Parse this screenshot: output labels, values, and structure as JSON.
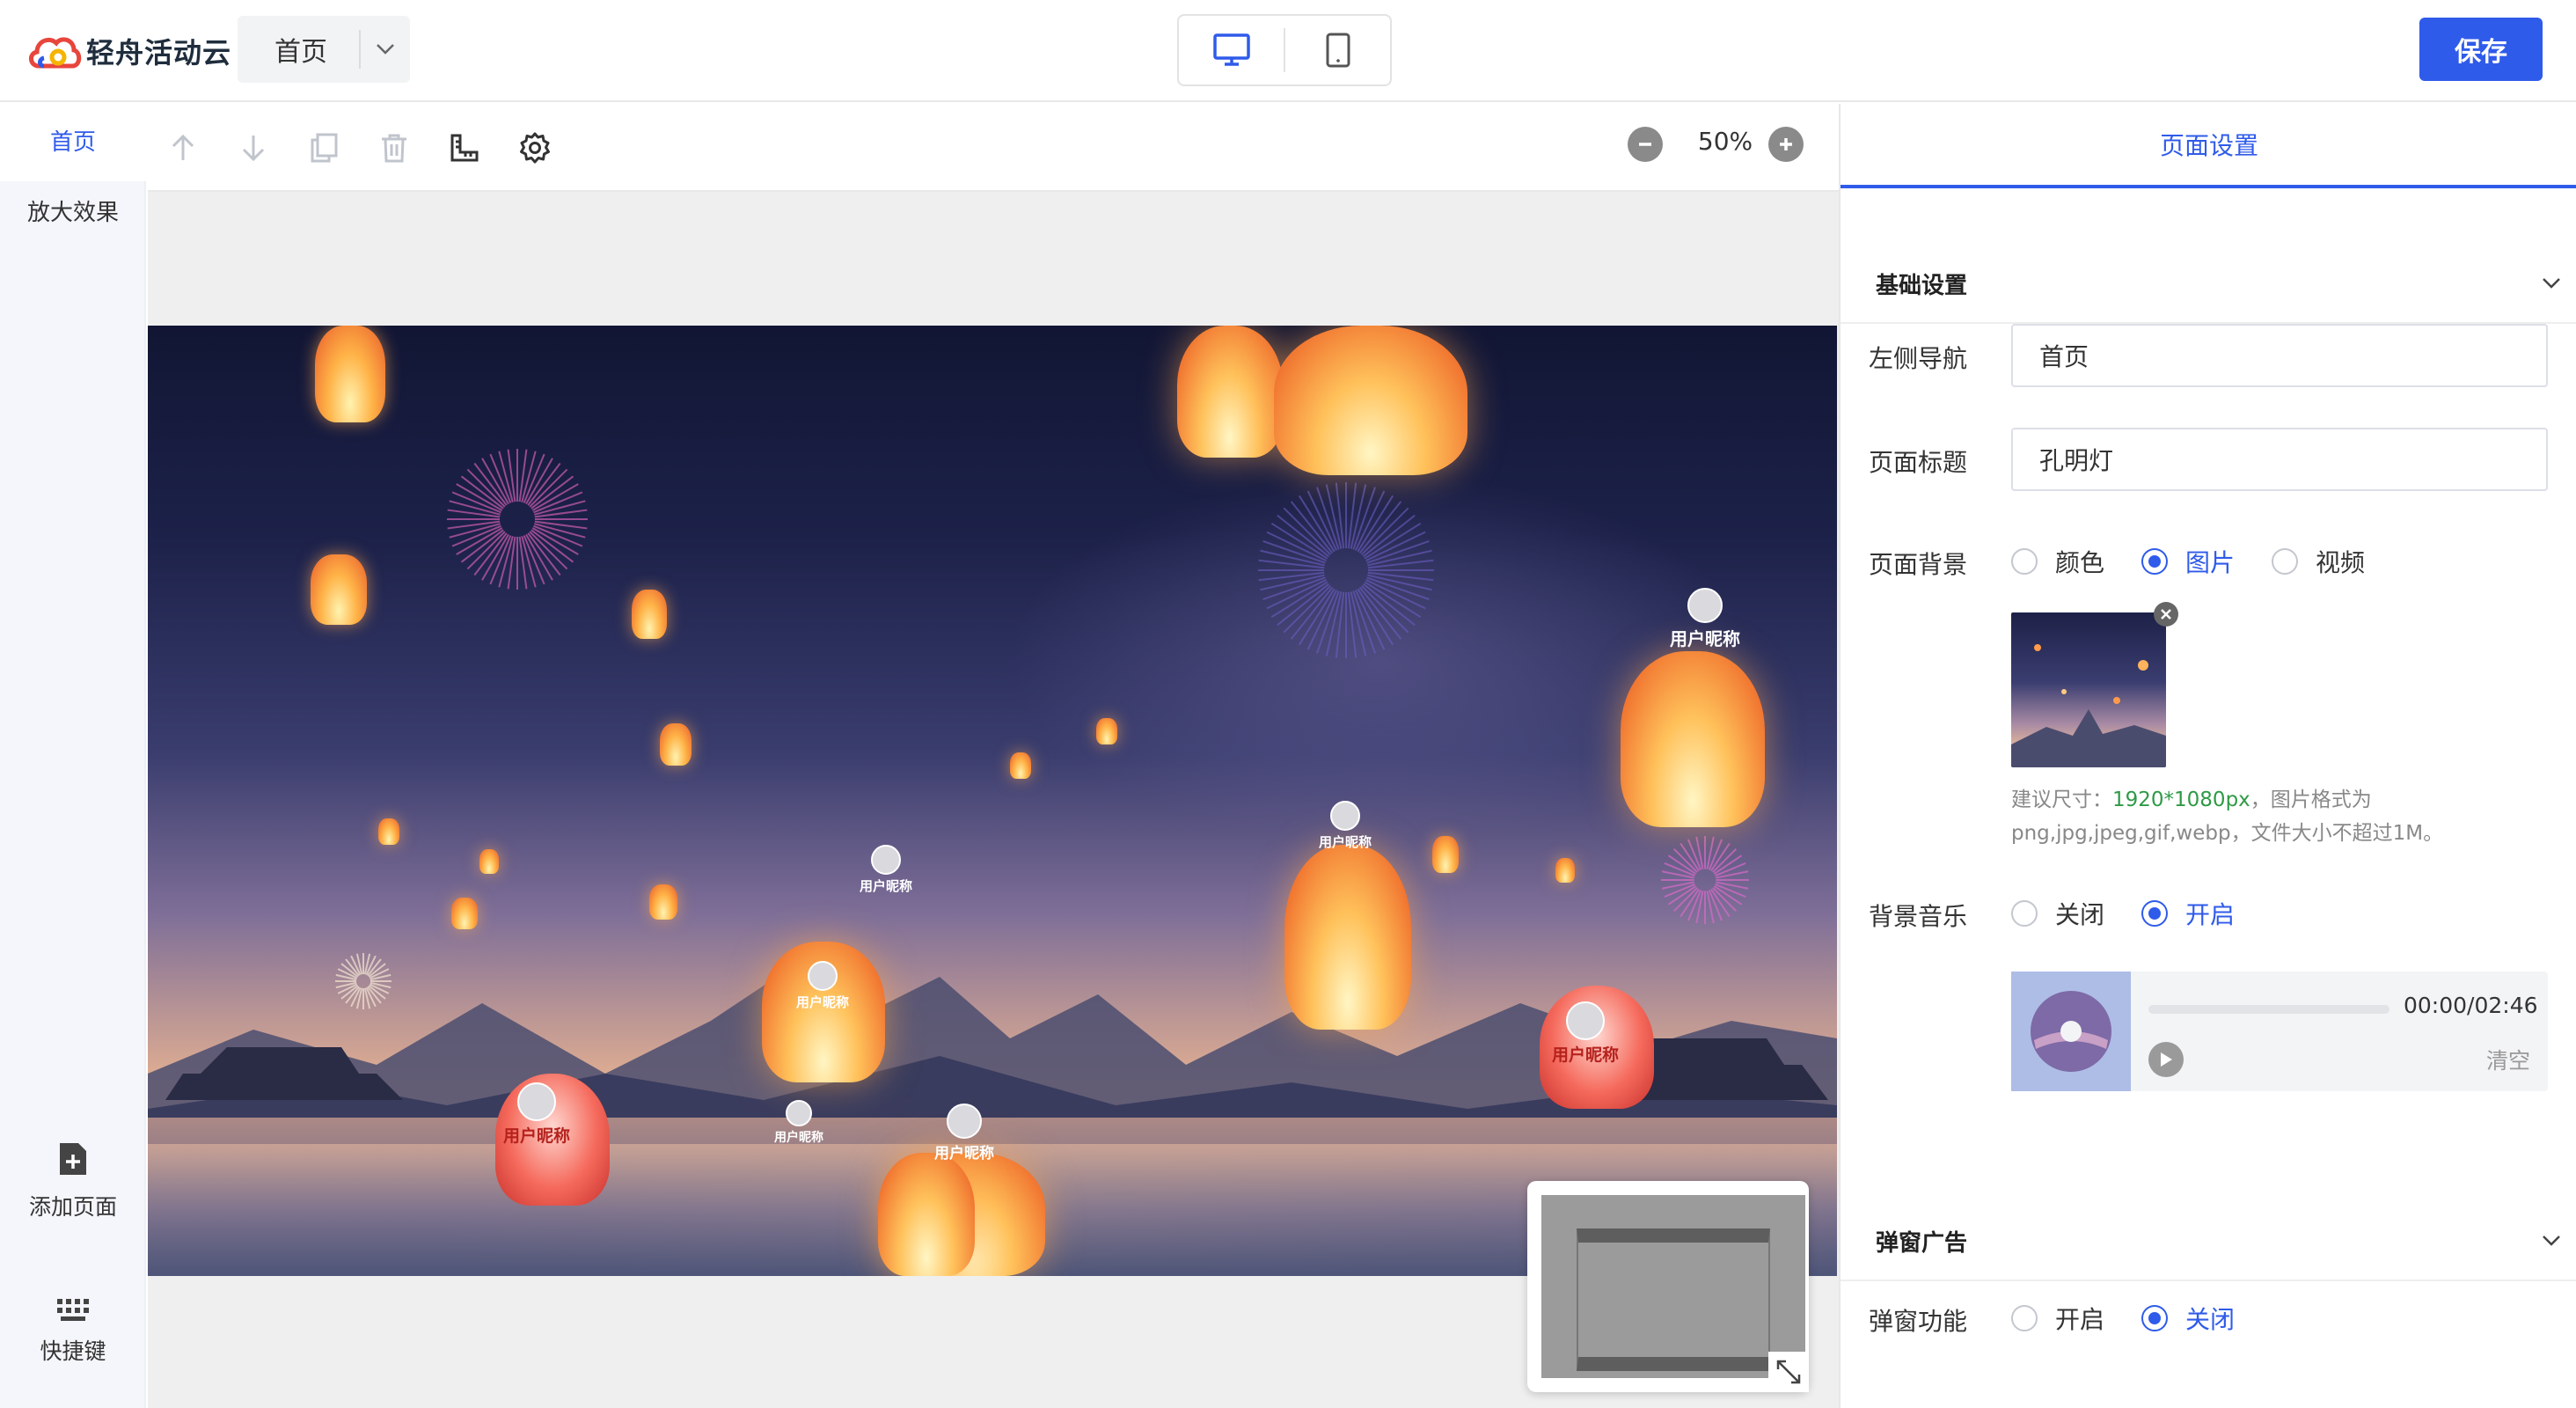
{
  "app": {
    "brand_name": "轻舟活动云",
    "current_page": "首页",
    "save_label": "保存"
  },
  "colors": {
    "accent": "#2f5bea",
    "hint_green": "#2e9a46"
  },
  "left_rail": {
    "pages": [
      {
        "label": "首页",
        "active": true
      },
      {
        "label": "放大效果",
        "active": false
      }
    ],
    "add_page_label": "添加页面",
    "shortcuts_label": "快捷键"
  },
  "toolbar": {
    "icons": [
      "arrow-up-icon",
      "arrow-down-icon",
      "copy-icon",
      "trash-icon",
      "ruler-icon",
      "gear-icon"
    ],
    "zoom": "50%"
  },
  "preview": {
    "nickname_labels": [
      "用户昵称",
      "用户昵称",
      "用户昵称",
      "用户昵称",
      "用户昵称",
      "用户昵称",
      "用户昵称",
      "用户昵称"
    ]
  },
  "panel": {
    "tab": "页面设置",
    "basic_section": "基础设置",
    "left_nav_label": "左侧导航",
    "left_nav_value": "首页",
    "title_label": "页面标题",
    "title_value": "孔明灯",
    "background_label": "页面背景",
    "background_options": [
      {
        "label": "颜色",
        "selected": false
      },
      {
        "label": "图片",
        "selected": true
      },
      {
        "label": "视频",
        "selected": false
      }
    ],
    "hint_prefix": "建议尺寸：",
    "hint_size": "1920*1080px",
    "hint_suffix": "，图片格式为png,jpg,jpeg,gif,webp，文件大小不超过1M。",
    "music_label": "背景音乐",
    "music_options": [
      {
        "label": "关闭",
        "selected": false
      },
      {
        "label": "开启",
        "selected": true
      }
    ],
    "music_time": "00:00/02:46",
    "music_clear": "清空",
    "popup_section": "弹窗广告",
    "popup_label": "弹窗功能",
    "popup_options": [
      {
        "label": "开启",
        "selected": false
      },
      {
        "label": "关闭",
        "selected": true
      }
    ]
  }
}
